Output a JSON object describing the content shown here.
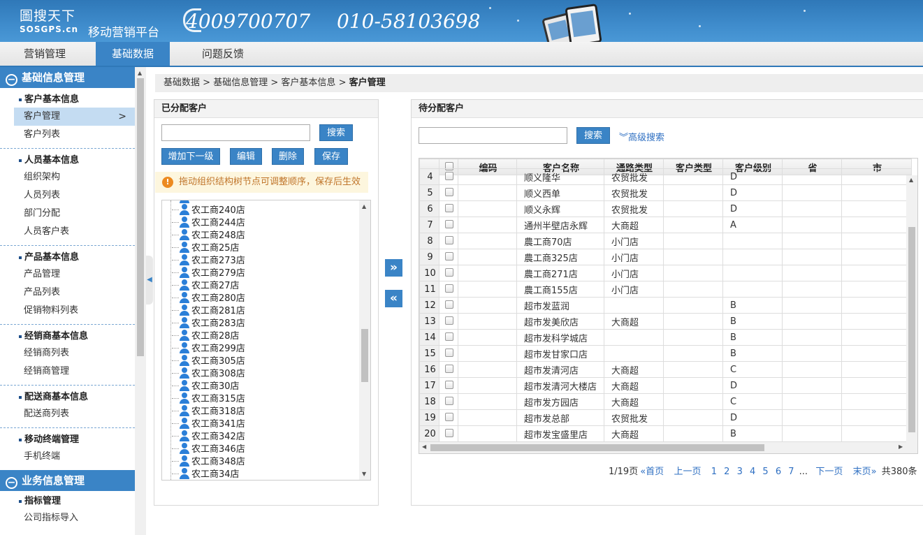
{
  "header": {
    "logo_line1": "圖搜天下",
    "logo_line2": "SOSGPS.cn",
    "platform": "移动营销平台",
    "phone1": "4009700707",
    "phone2": "010-58103698"
  },
  "nav": {
    "tabs": [
      "营销管理",
      "基础数据",
      "问题反馈"
    ],
    "active": 1
  },
  "sidebar": {
    "section1": "基础信息管理",
    "groups": [
      {
        "title": "客户基本信息",
        "items": [
          "客户管理",
          "客户列表"
        ]
      },
      {
        "title": "人员基本信息",
        "items": [
          "组织架构",
          "人员列表",
          "部门分配",
          "人员客户表"
        ]
      },
      {
        "title": "产品基本信息",
        "items": [
          "产品管理",
          "产品列表",
          "促销物料列表"
        ]
      },
      {
        "title": "经销商基本信息",
        "items": [
          "经销商列表",
          "经销商管理"
        ]
      },
      {
        "title": "配送商基本信息",
        "items": [
          "配送商列表"
        ]
      },
      {
        "title": "移动终端管理",
        "items": [
          "手机终端"
        ]
      }
    ],
    "section2": "业务信息管理",
    "group2": {
      "title": "指标管理",
      "items": [
        "公司指标导入"
      ]
    }
  },
  "breadcrumb": {
    "parts": [
      "基础数据",
      "基础信息管理",
      "客户基本信息"
    ],
    "current": "客户管理",
    "sep": ">"
  },
  "left_panel": {
    "title": "已分配客户",
    "search_btn": "搜索",
    "buttons": [
      "增加下一级",
      "编辑",
      "删除",
      "保存"
    ],
    "notice": "拖动组织结构树节点可调整顺序，保存后生效",
    "tree_nodes": [
      "农工商240店",
      "农工商244店",
      "农工商248店",
      "农工商25店",
      "农工商273店",
      "农工商279店",
      "农工商27店",
      "农工商280店",
      "农工商281店",
      "农工商283店",
      "农工商28店",
      "农工商299店",
      "农工商305店",
      "农工商308店",
      "农工商30店",
      "农工商315店",
      "农工商318店",
      "农工商341店",
      "农工商342店",
      "农工商346店",
      "农工商348店",
      "农工商34店"
    ]
  },
  "right_panel": {
    "title": "待分配客户",
    "search_btn": "搜索",
    "advanced": "高级搜索",
    "columns": [
      "编码",
      "客户名称",
      "通路类型",
      "客户类型",
      "客户级别",
      "省",
      "市"
    ],
    "rows": [
      {
        "n": "4",
        "name": "顺义隆华",
        "channel": "农贸批发",
        "level": "D"
      },
      {
        "n": "5",
        "name": "顺义西单",
        "channel": "农贸批发",
        "level": "D"
      },
      {
        "n": "6",
        "name": "顺义永辉",
        "channel": "农贸批发",
        "level": "D"
      },
      {
        "n": "7",
        "name": "通州半壁店永辉",
        "channel": "大商超",
        "level": "A"
      },
      {
        "n": "8",
        "name": "農工商70店",
        "channel": "小门店",
        "level": ""
      },
      {
        "n": "9",
        "name": "農工商325店",
        "channel": "小门店",
        "level": ""
      },
      {
        "n": "10",
        "name": "農工商271店",
        "channel": "小门店",
        "level": ""
      },
      {
        "n": "11",
        "name": "農工商155店",
        "channel": "小门店",
        "level": ""
      },
      {
        "n": "12",
        "name": "超市发蓝润",
        "channel": "",
        "level": "B"
      },
      {
        "n": "13",
        "name": "超市发美欣店",
        "channel": "大商超",
        "level": "B"
      },
      {
        "n": "14",
        "name": "超市发科学城店",
        "channel": "",
        "level": "B"
      },
      {
        "n": "15",
        "name": "超市发甘家口店",
        "channel": "",
        "level": "B"
      },
      {
        "n": "16",
        "name": "超市发清河店",
        "channel": "大商超",
        "level": "C"
      },
      {
        "n": "17",
        "name": "超市发清河大楼店",
        "channel": "大商超",
        "level": "D"
      },
      {
        "n": "18",
        "name": "超市发方园店",
        "channel": "大商超",
        "level": "C"
      },
      {
        "n": "19",
        "name": "超市发总部",
        "channel": "农贸批发",
        "level": "D"
      },
      {
        "n": "20",
        "name": "超市发宝盛里店",
        "channel": "大商超",
        "level": "B"
      }
    ],
    "pager": {
      "info": "1/19页",
      "first": "«首页",
      "prev": "上一页",
      "pages": [
        "1",
        "2",
        "3",
        "4",
        "5",
        "6",
        "7"
      ],
      "ellipsis": "...",
      "next": "下一页",
      "last": "末页»",
      "total": "共380条"
    }
  },
  "colors": {
    "primary": "#3a84c6",
    "header": "#2f78b8"
  }
}
